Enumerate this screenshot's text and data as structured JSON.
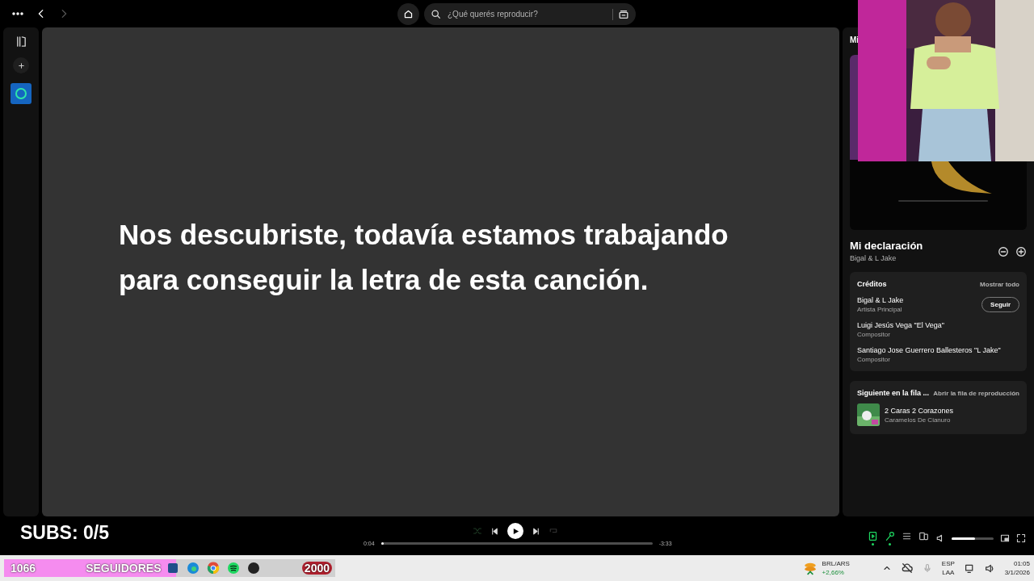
{
  "topbar": {
    "search": {
      "placeholder": "¿Qué querés reproducir?"
    }
  },
  "lyrics": "Nos descubriste, todavía estamos trabajando para conseguir la letra de esta canción.",
  "right_panel": {
    "header": "Mi",
    "title": "Mi declaración",
    "artist": "Bigal & L Jake",
    "credits": {
      "heading": "Créditos",
      "show_all": "Mostrar todo",
      "people": [
        {
          "name": "Bigal & L Jake",
          "role": "Artista Principal",
          "follow": "Seguir"
        },
        {
          "name": "Luigi Jesús Vega \"El Vega\"",
          "role": "Compositor"
        },
        {
          "name": "Santiago Jose Guerrero Ballesteros \"L Jake\"",
          "role": "Compositor"
        }
      ]
    },
    "next": {
      "heading": "Siguiente en la fila ...",
      "open_queue": "Abrir la fila de reproducción",
      "track": {
        "title": "2 Caras 2 Corazones",
        "artist": "Caramelos De Cianuro"
      }
    }
  },
  "player": {
    "elapsed": "0:04",
    "remaining": "-3:33",
    "progress": {
      "level": 0.01
    },
    "volume": {
      "level": 0.55
    },
    "tools": [
      {
        "kind": "now-playing",
        "active": true
      },
      {
        "kind": "lyrics",
        "active": true
      },
      {
        "kind": "queue",
        "active": false
      },
      {
        "kind": "devices",
        "active": false
      }
    ]
  },
  "overlay": {
    "subs": "SUBS: 0/5",
    "followers": {
      "count": "1066",
      "label": "SEGUIDORES",
      "goal": "2000",
      "level": 0.52
    }
  },
  "taskbar": {
    "ticker": {
      "pair": "BRL/ARS",
      "change": "+2,66%"
    },
    "lang": "ESP",
    "layout": "LAA",
    "time": "01:05",
    "date": "3/1/2026"
  }
}
